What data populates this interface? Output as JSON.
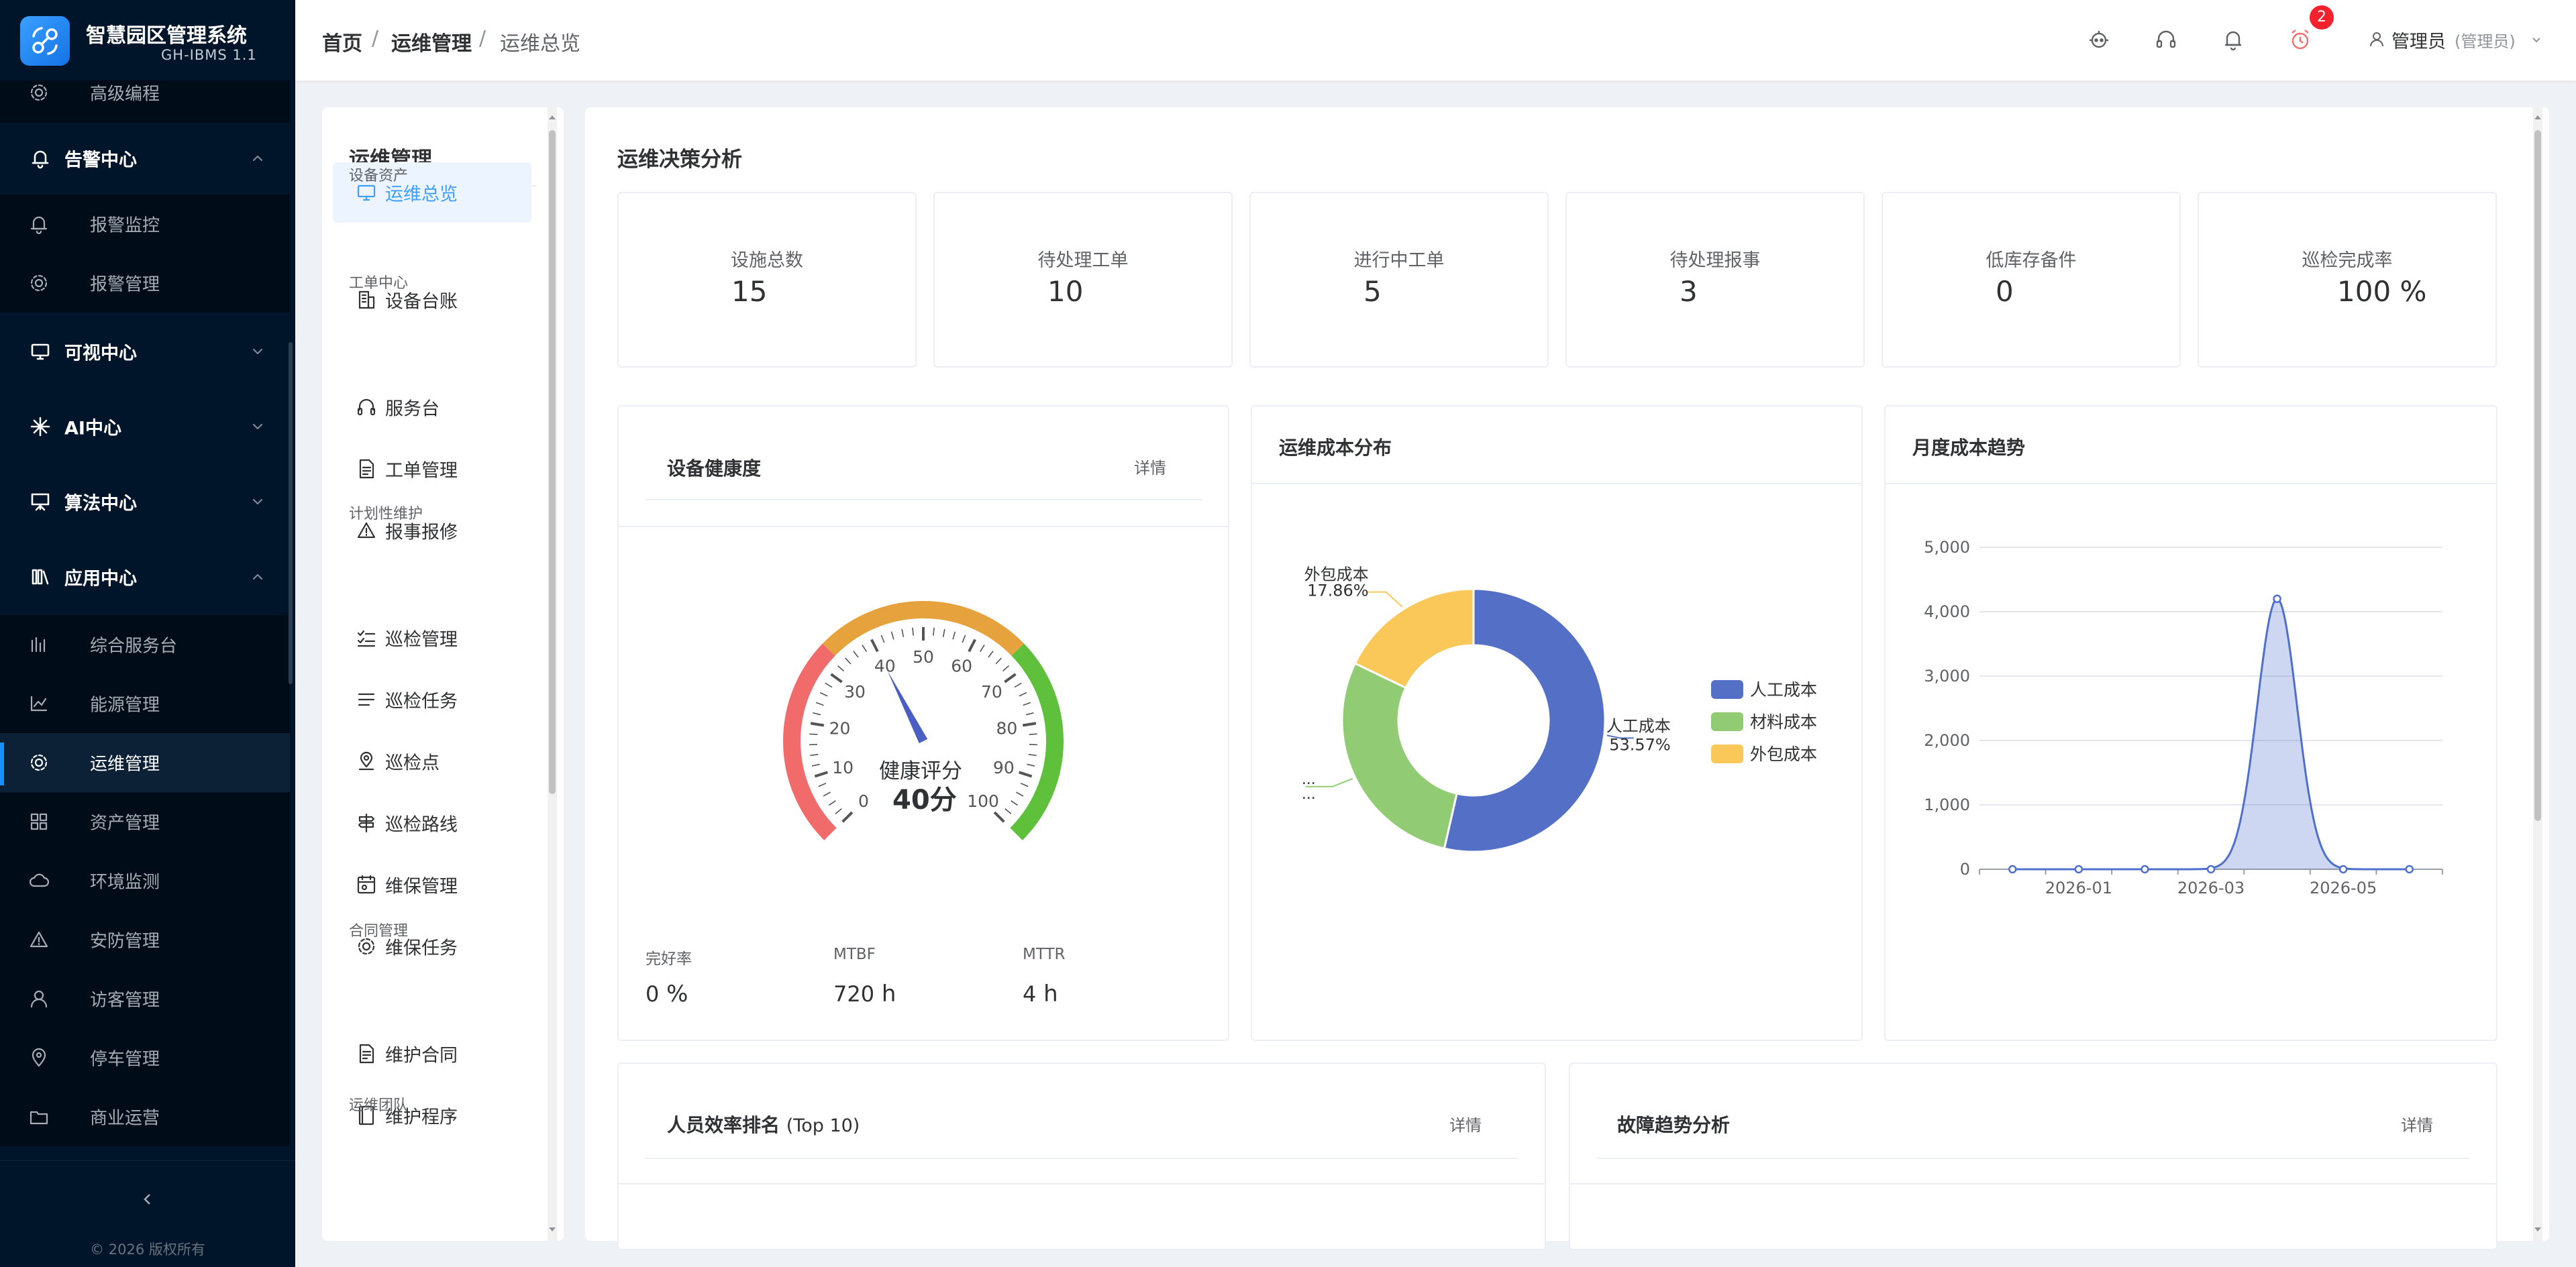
{
  "app": {
    "title": "智慧园区管理系统",
    "version": "GH-IBMS 1.1",
    "copyright": "© 2026 版权所有"
  },
  "sidebar": {
    "items": [
      {
        "label": "高级编程",
        "kind": "sub",
        "icon": "gear-icon"
      },
      {
        "label": "告警中心",
        "kind": "group",
        "icon": "bell-icon",
        "expanded": true
      },
      {
        "label": "报警监控",
        "kind": "sub",
        "icon": "bell-icon"
      },
      {
        "label": "报警管理",
        "kind": "sub",
        "icon": "gear-icon"
      },
      {
        "label": "可视中心",
        "kind": "group",
        "icon": "monitor-icon",
        "expanded": false
      },
      {
        "label": "AI中心",
        "kind": "group",
        "icon": "sparkle-icon",
        "expanded": false
      },
      {
        "label": "算法中心",
        "kind": "group",
        "icon": "presentation-icon",
        "expanded": false
      },
      {
        "label": "应用中心",
        "kind": "group",
        "icon": "apps-icon",
        "expanded": true
      },
      {
        "label": "综合服务台",
        "kind": "sub",
        "icon": "bar-chart-icon"
      },
      {
        "label": "能源管理",
        "kind": "sub",
        "icon": "line-chart-icon"
      },
      {
        "label": "运维管理",
        "kind": "sub",
        "icon": "gear-icon",
        "active": true
      },
      {
        "label": "资产管理",
        "kind": "sub",
        "icon": "grid-icon"
      },
      {
        "label": "环境监测",
        "kind": "sub",
        "icon": "cloud-icon"
      },
      {
        "label": "安防管理",
        "kind": "sub",
        "icon": "warning-icon"
      },
      {
        "label": "访客管理",
        "kind": "sub",
        "icon": "user-icon"
      },
      {
        "label": "停车管理",
        "kind": "sub",
        "icon": "location-icon"
      },
      {
        "label": "商业运营",
        "kind": "sub",
        "icon": "folder-icon"
      }
    ],
    "collapse_icon": "chevron-left-icon"
  },
  "header": {
    "breadcrumb": [
      "首页",
      "运维管理",
      "运维总览"
    ],
    "separator": "/",
    "icons": [
      "robot-icon",
      "headset-icon",
      "bell-icon",
      "alarm-clock-icon"
    ],
    "alarm_badge": "2",
    "user_name": "管理员",
    "user_role": "(管理员)"
  },
  "menu": {
    "title": "运维管理",
    "groups": [
      {
        "category": "",
        "items": [
          {
            "label": "运维总览",
            "icon": "monitor-icon",
            "selected": true
          }
        ]
      },
      {
        "category": "设备资产",
        "items": [
          {
            "label": "设备台账",
            "icon": "building-icon"
          }
        ]
      },
      {
        "category": "工单中心",
        "items": [
          {
            "label": "服务台",
            "icon": "headset-icon"
          },
          {
            "label": "工单管理",
            "icon": "document-icon"
          },
          {
            "label": "报事报修",
            "icon": "warning-icon"
          }
        ]
      },
      {
        "category": "计划性维护",
        "items": [
          {
            "label": "巡检管理",
            "icon": "checklist-icon"
          },
          {
            "label": "巡检任务",
            "icon": "list-icon"
          },
          {
            "label": "巡检点",
            "icon": "map-pin-icon"
          },
          {
            "label": "巡检路线",
            "icon": "signpost-icon"
          },
          {
            "label": "维保管理",
            "icon": "calendar-icon"
          },
          {
            "label": "维保任务",
            "icon": "gear-icon"
          }
        ]
      },
      {
        "category": "合同管理",
        "items": [
          {
            "label": "维护合同",
            "icon": "contract-icon"
          },
          {
            "label": "维护程序",
            "icon": "book-icon"
          }
        ]
      },
      {
        "category": "运维团队",
        "items": []
      }
    ]
  },
  "dashboard": {
    "title": "运维决策分析",
    "kpis": [
      {
        "label": "设施总数",
        "value": "15"
      },
      {
        "label": "待处理工单",
        "value": "10"
      },
      {
        "label": "进行中工单",
        "value": "5"
      },
      {
        "label": "待处理报事",
        "value": "3"
      },
      {
        "label": "低库存备件",
        "value": "0"
      },
      {
        "label": "巡检完成率",
        "value": "100 %"
      }
    ],
    "health": {
      "title": "设备健康度",
      "more": "详情",
      "gauge_label": "健康评分",
      "score": 40,
      "score_text": "40分",
      "ticks": [
        "0",
        "10",
        "20",
        "30",
        "40",
        "50",
        "60",
        "70",
        "80",
        "90",
        "100"
      ],
      "stats": [
        {
          "label": "完好率",
          "value": "0",
          "unit": "%"
        },
        {
          "label": "MTBF",
          "value": "720",
          "unit": "h"
        },
        {
          "label": "MTTR",
          "value": "4",
          "unit": "h"
        }
      ],
      "colors": {
        "low": "#f26b6b",
        "mid": "#e6a23c",
        "high": "#5fc13b",
        "needle": "#4a5fc1"
      }
    },
    "cost_dist": {
      "title": "运维成本分布"
    },
    "cost_trend": {
      "title": "月度成本趋势"
    },
    "ranking": {
      "title": "人员效率排名",
      "suffix": "(Top 10)",
      "more": "详情"
    },
    "fault": {
      "title": "故障趋势分析",
      "more": "详情"
    }
  },
  "chart_data": [
    {
      "type": "pie",
      "title": "运维成本分布",
      "legend_position": "right",
      "slices": [
        {
          "name": "人工成本",
          "value": 53.57,
          "label": "53.57%",
          "color": "#5470c6"
        },
        {
          "name": "材料成本",
          "value": 28.57,
          "label": "...",
          "color": "#91cc75"
        },
        {
          "name": "外包成本",
          "value": 17.86,
          "label": "17.86%",
          "color": "#fac858"
        }
      ],
      "truncated_label": "..."
    },
    {
      "type": "area",
      "title": "月度成本趋势",
      "x": [
        "2025-12",
        "2026-01",
        "2026-02",
        "2026-03",
        "2026-04",
        "2026-05",
        "2026-06"
      ],
      "x_tick_labels": [
        "2026-01",
        "2026-03",
        "2026-05"
      ],
      "y_ticks": [
        0,
        1000,
        2000,
        3000,
        4000,
        5000
      ],
      "y_tick_labels": [
        "0",
        "1,000",
        "2,000",
        "3,000",
        "4,000",
        "5,000"
      ],
      "ylim": [
        0,
        5000
      ],
      "series": [
        {
          "values": [
            0,
            0,
            0,
            0,
            4200,
            0,
            0
          ],
          "color": "#4f6fce"
        }
      ],
      "grid": true
    }
  ]
}
